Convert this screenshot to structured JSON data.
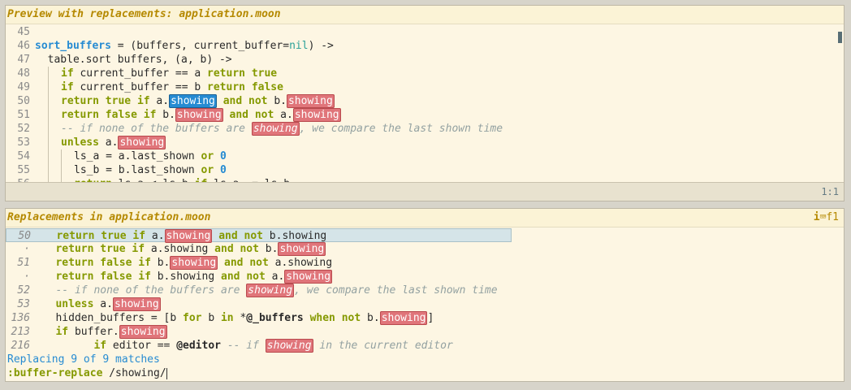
{
  "preview": {
    "title": "Preview with replacements: application.moon",
    "status": "1:1"
  },
  "replacements": {
    "title": "Replacements in application.moon",
    "header_right": "f1",
    "info_icon": "info-icon",
    "info": "Replacing 9 of 9 matches",
    "command_prefix": ":buffer-replace",
    "command_arg": " /showing/"
  },
  "search_term": "showing",
  "colors": {
    "keyword": "#859900",
    "function": "#268bd2",
    "match": "#e0757a",
    "current_match": "#268bd2",
    "header": "#b58900"
  }
}
